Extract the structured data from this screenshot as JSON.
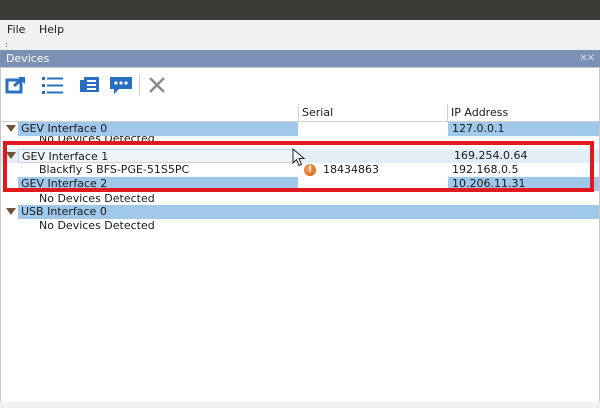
{
  "menu": {
    "file": "File",
    "help": "Help"
  },
  "panel": {
    "title": "Devices",
    "close_glyph": "✕✕"
  },
  "toolbar": {
    "buttons": [
      {
        "icon": "arrow-out-icon"
      },
      {
        "icon": "list-icon"
      },
      {
        "icon": "property-grid-icon"
      },
      {
        "icon": "chat-icon"
      },
      {
        "icon": "close-icon"
      }
    ]
  },
  "columns": {
    "name": "",
    "serial": "Serial",
    "ip": "IP Address"
  },
  "rows": [
    {
      "name": "GEV Interface 0",
      "serial": "",
      "ip": "127.0.0.1"
    },
    {
      "name": "No Devices Detected",
      "serial": "",
      "ip": ""
    },
    {
      "name": "GEV Interface 1",
      "serial": "",
      "ip": "169.254.0.64"
    },
    {
      "name": "Blackfly S BFS-PGE-51S5PC",
      "serial": "18434863",
      "ip": "192.168.0.5"
    },
    {
      "name": "GEV Interface 2",
      "serial": "",
      "ip": "10.206.11.31"
    },
    {
      "name": "No Devices Detected",
      "serial": "",
      "ip": ""
    },
    {
      "name": "USB Interface 0",
      "serial": "",
      "ip": ""
    },
    {
      "name": "No Devices Detected",
      "serial": "",
      "ip": ""
    }
  ],
  "colors": {
    "selection": "#9fc8ea",
    "panel_header": "#7a90b4",
    "highlight_box": "#e0191f",
    "expand_arrow": "#6d5237"
  }
}
